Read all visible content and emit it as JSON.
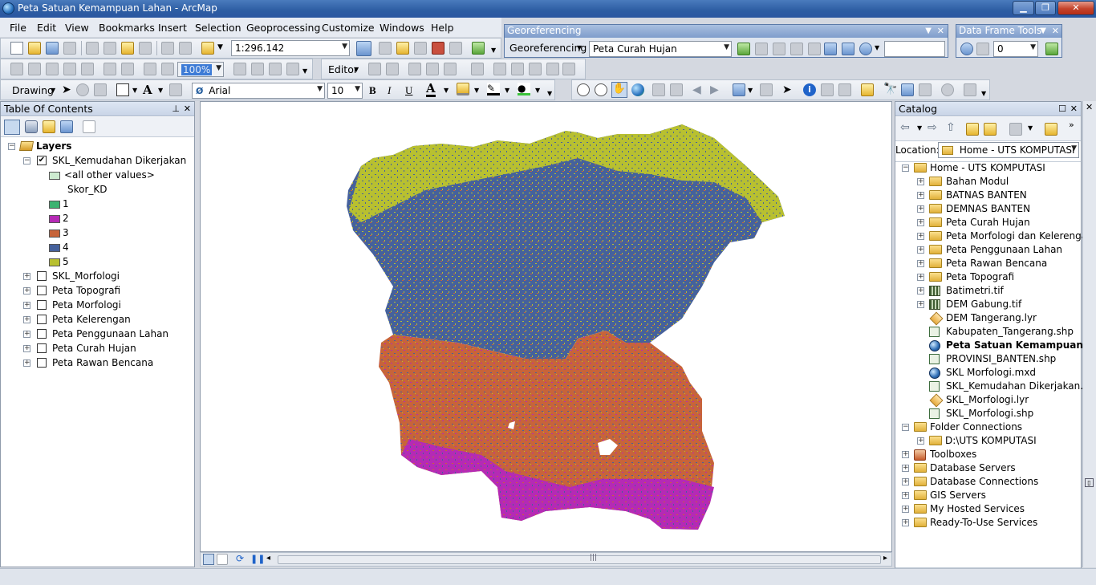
{
  "window": {
    "title": "Peta Satuan Kemampuan Lahan - ArcMap",
    "min_icon": "minimize-icon",
    "max_icon": "maximize-icon",
    "close_icon": "close-icon"
  },
  "menu": [
    "File",
    "Edit",
    "View",
    "Bookmarks",
    "Insert",
    "Selection",
    "Geoprocessing",
    "Customize",
    "Windows",
    "Help"
  ],
  "standard_toolbar": {
    "scale": "1:296.142"
  },
  "georef_toolbar": {
    "title": "Georeferencing",
    "menu_label": "Georeferencing",
    "layer_value": "Peta Curah Hujan"
  },
  "dataframe_toolbar": {
    "title": "Data Frame Tools",
    "combo_value": "0"
  },
  "edit_toolbar": {
    "zoom_value": "100%",
    "editor_label": "Editor"
  },
  "drawing_toolbar": {
    "drawing_label": "Drawing",
    "font_value": "Arial",
    "size_value": "10",
    "bold": "B",
    "italic": "I",
    "underline": "U",
    "font_color_label": "A"
  },
  "toc": {
    "title": "Table Of Contents",
    "root": "Layers",
    "main_layer": "SKL_Kemudahan Dikerjakan",
    "other_values": "<all other values>",
    "field_name": "Skor_KD",
    "classes": [
      {
        "label": "1",
        "color": "#3cb371"
      },
      {
        "label": "2",
        "color": "#b52ab5"
      },
      {
        "label": "3",
        "color": "#c7643a"
      },
      {
        "label": "4",
        "color": "#45619c"
      },
      {
        "label": "5",
        "color": "#b8c030"
      }
    ],
    "other_layers": [
      "SKL_Morfologi",
      "Peta Topografi",
      "Peta Morfologi",
      "Peta Kelerengan",
      "Peta Penggunaan Lahan",
      "Peta Curah Hujan",
      "Peta Rawan Bencana"
    ]
  },
  "catalog": {
    "title": "Catalog",
    "location_label": "Location:",
    "location_value": "Home - UTS KOMPUTASI",
    "home": "Home - UTS KOMPUTASI",
    "home_children": [
      {
        "label": "Bahan Modul",
        "type": "folder",
        "expandable": true
      },
      {
        "label": "BATNAS BANTEN",
        "type": "folder",
        "expandable": true
      },
      {
        "label": "DEMNAS BANTEN",
        "type": "folder",
        "expandable": true
      },
      {
        "label": "Peta Curah Hujan",
        "type": "folder",
        "expandable": true
      },
      {
        "label": "Peta Morfologi dan Kelerengan",
        "type": "folder",
        "expandable": true
      },
      {
        "label": "Peta Penggunaan Lahan",
        "type": "folder",
        "expandable": true
      },
      {
        "label": "Peta Rawan Bencana",
        "type": "folder",
        "expandable": true
      },
      {
        "label": "Peta Topografi",
        "type": "folder",
        "expandable": true
      },
      {
        "label": "Batimetri.tif",
        "type": "raster",
        "expandable": true
      },
      {
        "label": "DEM Gabung.tif",
        "type": "raster",
        "expandable": true
      },
      {
        "label": "DEM Tangerang.lyr",
        "type": "lyr",
        "expandable": false
      },
      {
        "label": "Kabupaten_Tangerang.shp",
        "type": "shp",
        "expandable": false
      },
      {
        "label": "Peta Satuan Kemampuan Lahan",
        "type": "mxd",
        "expandable": false,
        "bold": true
      },
      {
        "label": "PROVINSI_BANTEN.shp",
        "type": "shp",
        "expandable": false
      },
      {
        "label": "SKL Morfologi.mxd",
        "type": "mxd",
        "expandable": false
      },
      {
        "label": "SKL_Kemudahan Dikerjakan.shp",
        "type": "shp",
        "expandable": false
      },
      {
        "label": "SKL_Morfologi.lyr",
        "type": "lyr",
        "expandable": false
      },
      {
        "label": "SKL_Morfologi.shp",
        "type": "shp",
        "expandable": false
      }
    ],
    "folder_connections": "Folder Connections",
    "folder_connection_child": "D:\\UTS KOMPUTASI",
    "others": [
      "Toolboxes",
      "Database Servers",
      "Database Connections",
      "GIS Servers",
      "My Hosted Services",
      "Ready-To-Use Services"
    ]
  }
}
